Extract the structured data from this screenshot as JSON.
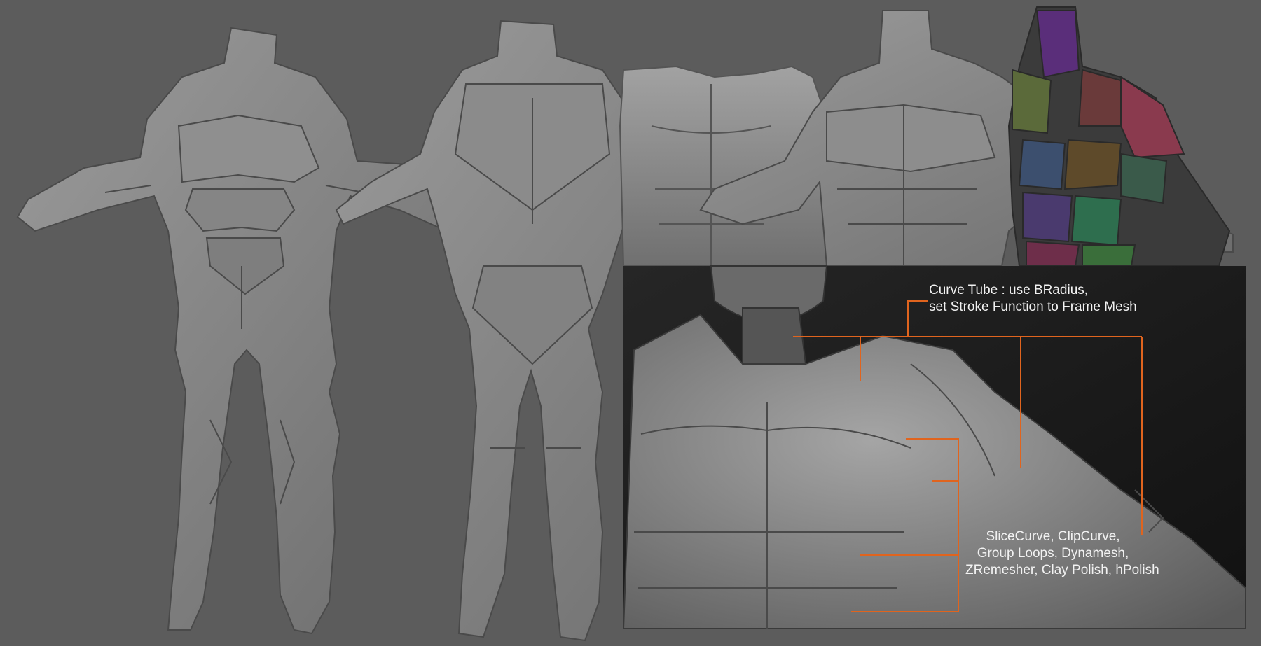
{
  "annotations": {
    "curve_tube": {
      "line1": "Curve Tube : use BRadius,",
      "line2": "set Stroke Function to Frame Mesh"
    },
    "slice_tools": {
      "line1": "SliceCurve, ClipCurve,",
      "line2": "Group Loops, Dynamesh,",
      "line3": "ZRemesher, Clay Polish, hPolish"
    }
  },
  "colors": {
    "background": "#5c5c5c",
    "leader_lines": "#e0641e",
    "annotation_text": "#f2f2f2",
    "clay": "#8a8a8a",
    "inset_dark": "#1c1c1c"
  },
  "views": [
    "front-full-body",
    "back-full-body",
    "front-torso",
    "front-torso-armored",
    "polypaint-torso",
    "closeup-inset"
  ]
}
